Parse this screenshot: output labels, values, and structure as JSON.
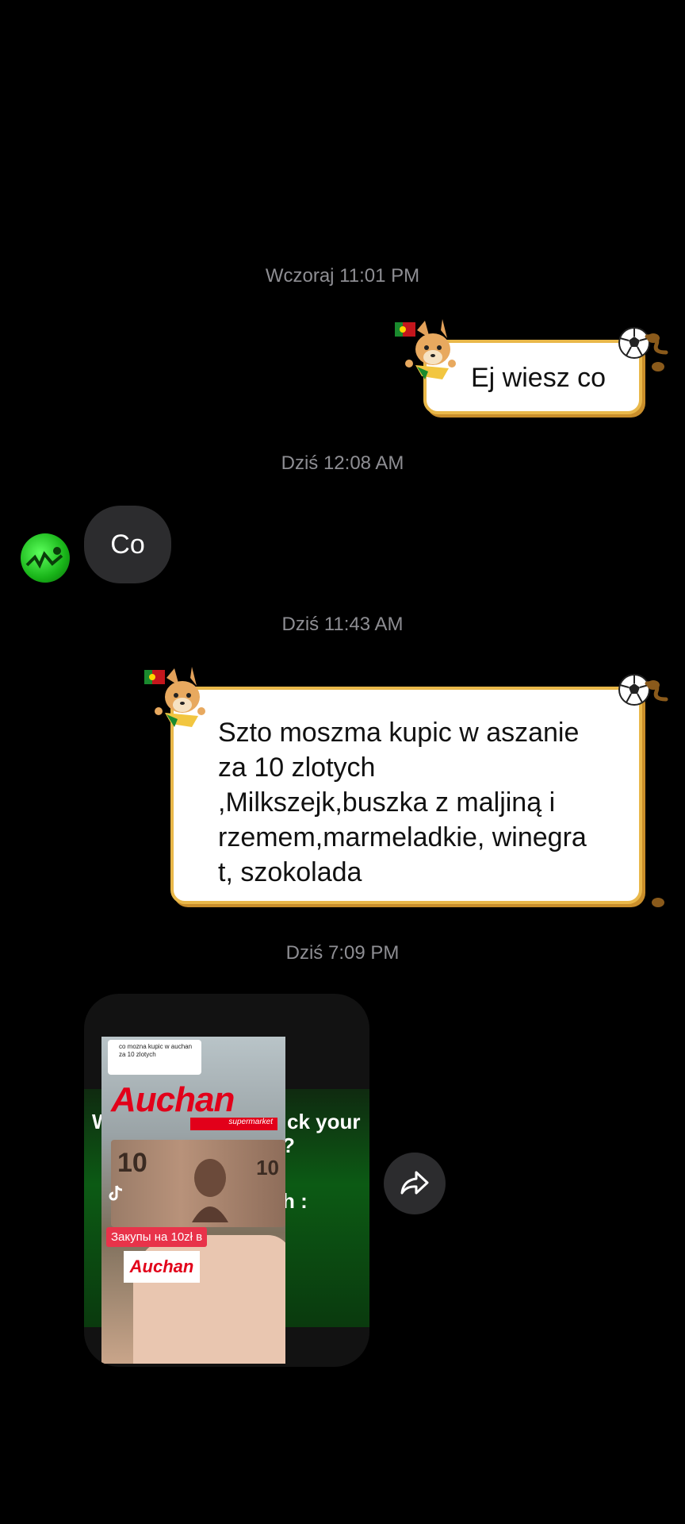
{
  "timestamps": [
    "Wczoraj 11:01 PM",
    "Dziś 12:08 AM",
    "Dziś 11:43 AM",
    "Dziś 7:09 PM"
  ],
  "messages": {
    "m1": "Ej wiesz co",
    "m2": "Co",
    "m3_lines": [
      "Szto moszma kupic w aszanie",
      "za 10 zlotych",
      ",Milkszejk,buszka z maljiną i",
      "rzemem,marmeladkie, winegra",
      "t, szokolada"
    ]
  },
  "video_post": {
    "caption_small": "co mozna kupic w auchan za 10 zlotych",
    "brand": "Auchan",
    "brand_sub": "supermarket",
    "overlay_text": "Закупы на 10zł в",
    "bg_text_1": "W",
    "bg_text_2": "ck your",
    "bg_text_3": "?",
    "bg_text_4": "h :",
    "note_number": "10"
  },
  "colors": {
    "bubble_border": "#e9b84a",
    "received_bubble": "#2c2c2e",
    "auchan_red": "#e2001a",
    "auchan_green": "#3aa935"
  },
  "icons": {
    "share": "share-arrow-icon",
    "avatar": "green-avatar-icon",
    "decor": "dog-sticker-icon"
  }
}
